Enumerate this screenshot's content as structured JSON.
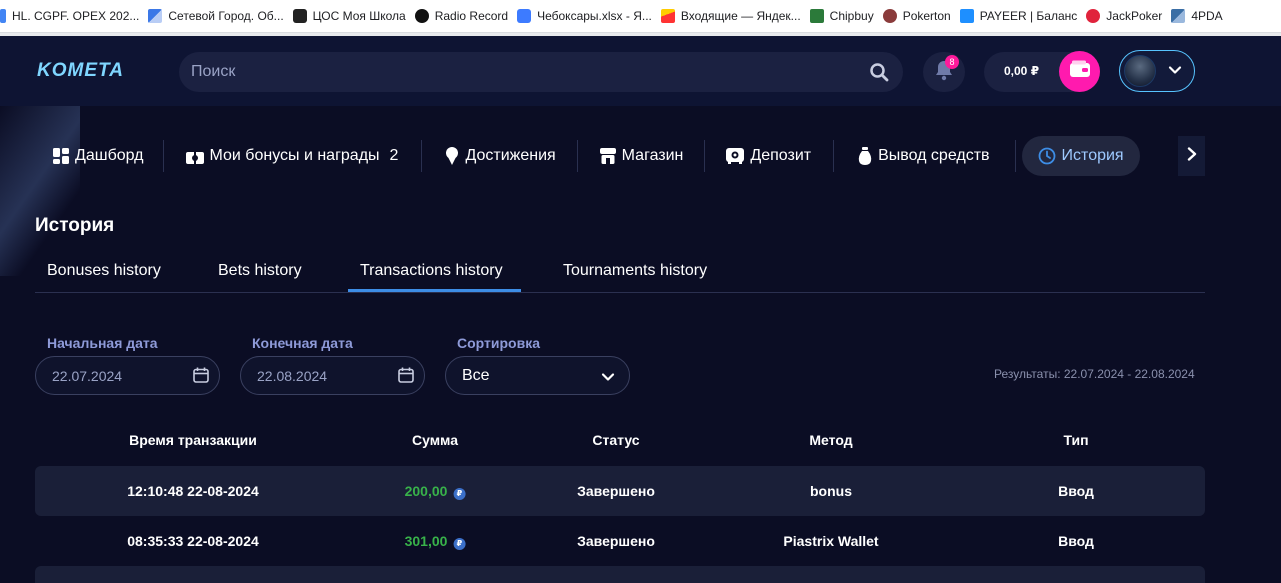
{
  "bookmarks": [
    {
      "label": "HL. CGPF. OPEX 202...",
      "icon": "doc-icon",
      "color": "#4285f4"
    },
    {
      "label": "Сетевой Город. Об...",
      "icon": "grid-icon",
      "color": "#3b78e7"
    },
    {
      "label": "ЦОС Моя Школа",
      "icon": "atom-icon",
      "color": "#222222"
    },
    {
      "label": "Radio Record",
      "icon": "record-icon",
      "color": "#111111"
    },
    {
      "label": "Чебоксары.xlsx - Я...",
      "icon": "cube-icon",
      "color": "#3d7bff"
    },
    {
      "label": "Входящие — Яндек...",
      "icon": "mail-icon",
      "color": "#ff3333"
    },
    {
      "label": "Chipbuy",
      "icon": "chip-icon",
      "color": "#2b7a3a"
    },
    {
      "label": "Pokerton",
      "icon": "poker-icon",
      "color": "#8a3b3b"
    },
    {
      "label": "PAYEER | Баланс",
      "icon": "payeer-icon",
      "color": "#1e8fff"
    },
    {
      "label": "JackPoker",
      "icon": "jack-icon",
      "color": "#e0233c"
    },
    {
      "label": "4PDA",
      "icon": "4pda-icon",
      "color": "#3a6ea5"
    }
  ],
  "header": {
    "logo": "KOMETA",
    "search_placeholder": "Поиск",
    "notifications": "8",
    "balance": "0,00 ₽"
  },
  "nav": [
    {
      "label": "Дашборд",
      "icon": "dashboard-icon"
    },
    {
      "label": "Мои бонусы и награды",
      "icon": "gift-icon",
      "count": "2"
    },
    {
      "label": "Достижения",
      "icon": "award-icon"
    },
    {
      "label": "Магазин",
      "icon": "shop-icon"
    },
    {
      "label": "Депозит",
      "icon": "deposit-icon"
    },
    {
      "label": "Вывод средств",
      "icon": "money-bag-icon"
    },
    {
      "label": "История",
      "icon": "clock-icon",
      "active": true
    }
  ],
  "page_title": "История",
  "history_tabs": [
    "Bonuses history",
    "Bets history",
    "Transactions history",
    "Tournaments history"
  ],
  "active_history_tab": "Transactions history",
  "filters": {
    "start_label": "Начальная дата",
    "start_value": "22.07.2024",
    "end_label": "Конечная дата",
    "end_value": "22.08.2024",
    "sort_label": "Сортировка",
    "sort_value": "Все",
    "results": "Результаты: 22.07.2024 - 22.08.2024"
  },
  "table": {
    "columns": [
      "Время транзакции",
      "Сумма",
      "Статус",
      "Метод",
      "Тип"
    ],
    "rows": [
      {
        "time": "12:10:48 22-08-2024",
        "amount": "200,00",
        "status": "Завершено",
        "method": "bonus",
        "type": "Ввод"
      },
      {
        "time": "08:35:33 22-08-2024",
        "amount": "301,00",
        "status": "Завершено",
        "method": "Piastrix Wallet",
        "type": "Ввод"
      }
    ],
    "currency_symbol": "₽"
  },
  "colors": {
    "accent": "#3d8de6",
    "pink": "#ff1aae",
    "positive": "#38b24a"
  }
}
